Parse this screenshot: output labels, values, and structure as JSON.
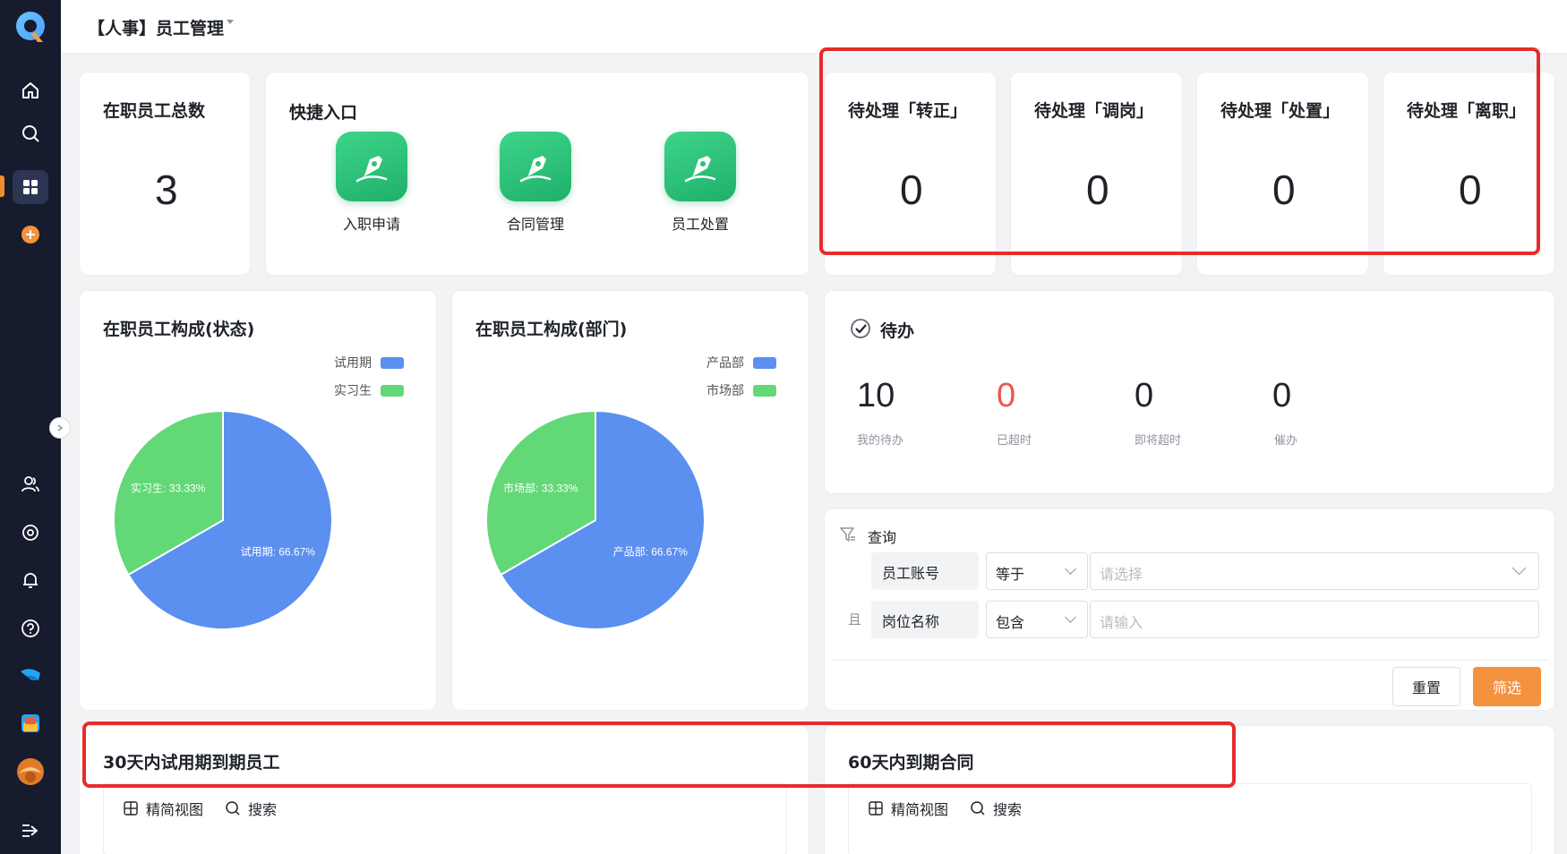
{
  "header": {
    "title": "【人事】员工管理"
  },
  "sidebar": {
    "icons": [
      "home-icon",
      "search-icon",
      "apps-icon",
      "add-icon",
      "users-icon",
      "settings-icon",
      "bell-icon",
      "help-icon",
      "brand-icon",
      "app-icon",
      "avatar",
      "expand-icon"
    ]
  },
  "stats": {
    "total_title": "在职员工总数",
    "total_value": "3",
    "pending": [
      {
        "title": "待处理「转正」",
        "value": "0"
      },
      {
        "title": "待处理「调岗」",
        "value": "0"
      },
      {
        "title": "待处理「处置」",
        "value": "0"
      },
      {
        "title": "待处理「离职」",
        "value": "0"
      }
    ]
  },
  "quick": {
    "title": "快捷入口",
    "items": [
      {
        "label": "入职申请"
      },
      {
        "label": "合同管理"
      },
      {
        "label": "员工处置"
      }
    ]
  },
  "chart_data": [
    {
      "type": "pie",
      "title": "在职员工构成(状态)",
      "series": [
        {
          "name": "试用期",
          "value": 66.67,
          "label": "试用期: 66.67%",
          "color": "#5b8ff0"
        },
        {
          "name": "实习生",
          "value": 33.33,
          "label": "实习生: 33.33%",
          "color": "#62d877"
        }
      ],
      "legend": "top-right"
    },
    {
      "type": "pie",
      "title": "在职员工构成(部门)",
      "series": [
        {
          "name": "产品部",
          "value": 66.67,
          "label": "产品部: 66.67%",
          "color": "#5b8ff0"
        },
        {
          "name": "市场部",
          "value": 33.33,
          "label": "市场部: 33.33%",
          "color": "#62d877"
        }
      ],
      "legend": "top-right"
    }
  ],
  "todo": {
    "title": "待办",
    "items": [
      {
        "value": "10",
        "label": "我的待办",
        "color": "#1f2329"
      },
      {
        "value": "0",
        "label": "已超时",
        "color": "#f0564a"
      },
      {
        "value": "0",
        "label": "即将超时",
        "color": "#1f2329"
      },
      {
        "value": "0",
        "label": "催办",
        "color": "#1f2329"
      }
    ]
  },
  "query": {
    "title": "查询",
    "connector": "且",
    "rows": [
      {
        "field": "员工账号",
        "operator": "等于",
        "placeholder": "请选择"
      },
      {
        "field": "岗位名称",
        "operator": "包含",
        "placeholder": "请输入"
      }
    ],
    "reset_label": "重置",
    "filter_label": "筛选"
  },
  "bottom": {
    "left_title": "30天内试用期到期员工",
    "right_title": "60天内到期合同",
    "view_label": "精简视图",
    "search_label": "搜索"
  },
  "colors": {
    "accent": "#f5923e",
    "highlight": "#e82b2b",
    "primary_green": "#2cc177"
  }
}
